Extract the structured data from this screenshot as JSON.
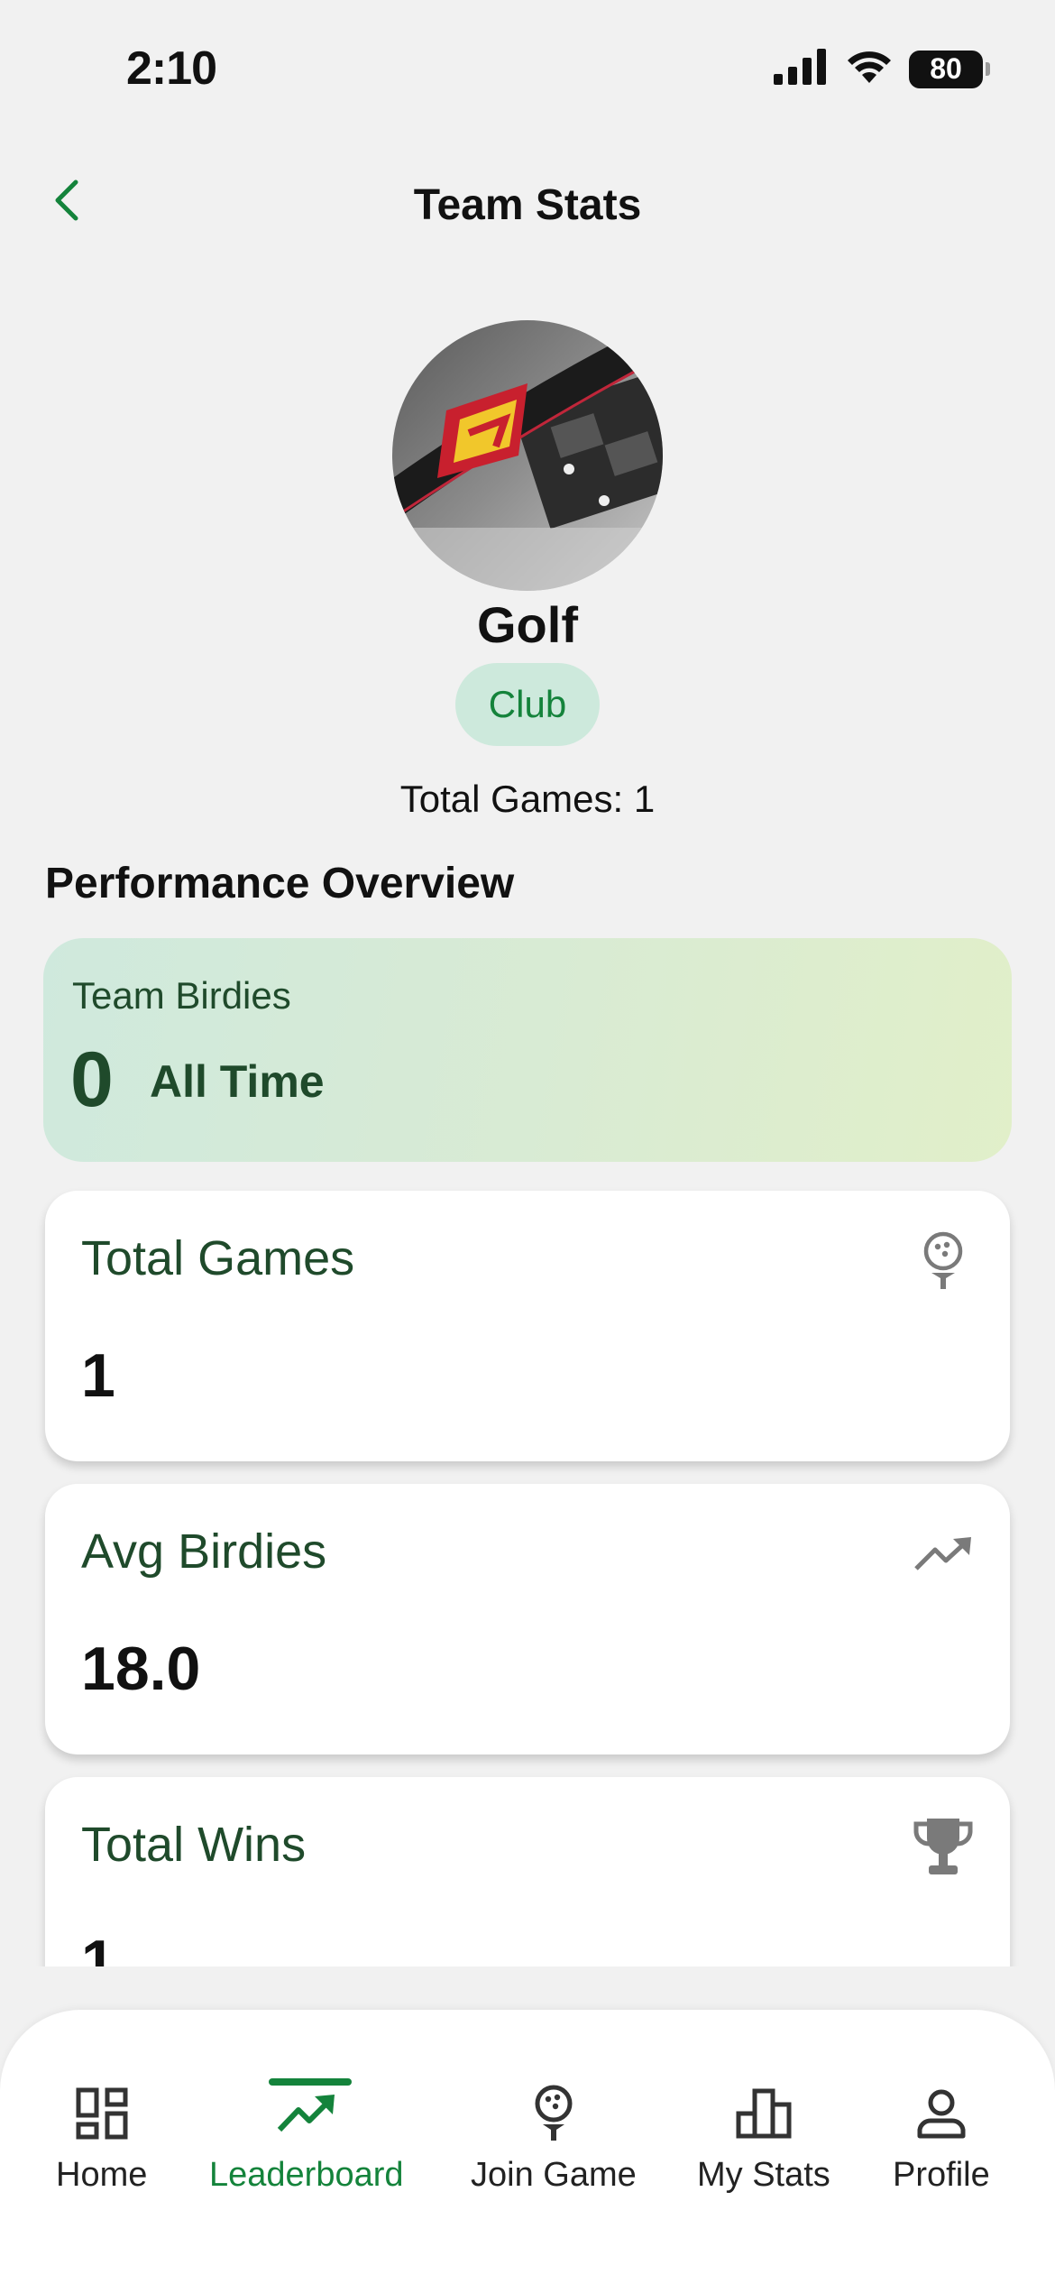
{
  "status_bar": {
    "time": "2:10",
    "battery": "80"
  },
  "header": {
    "title": "Team Stats",
    "back_icon": "chevron-left-icon"
  },
  "team": {
    "name": "Golf",
    "badge": "Club",
    "total_games_text": "Total Games: 1"
  },
  "performance": {
    "section_title": "Performance Overview",
    "birdies": {
      "label": "Team Birdies",
      "value": "0",
      "period": "All Time"
    },
    "cards": [
      {
        "label": "Total Games",
        "value": "1",
        "icon": "golf-ball-tee-icon"
      },
      {
        "label": "Avg Birdies",
        "value": "18.0",
        "icon": "trending-up-icon"
      },
      {
        "label": "Total Wins",
        "value": "1",
        "icon": "trophy-icon"
      }
    ]
  },
  "nav": {
    "items": [
      {
        "label": "Home",
        "icon": "dashboard-icon"
      },
      {
        "label": "Leaderboard",
        "icon": "trending-up-icon",
        "active": true
      },
      {
        "label": "Join Game",
        "icon": "golf-ball-tee-icon"
      },
      {
        "label": "My Stats",
        "icon": "bar-chart-icon"
      },
      {
        "label": "Profile",
        "icon": "person-icon"
      }
    ]
  },
  "colors": {
    "accent": "#14833b",
    "text_dark_green": "#1f4a2b",
    "badge_bg": "#cde9dc",
    "icon_gray": "#7a7a7a"
  }
}
